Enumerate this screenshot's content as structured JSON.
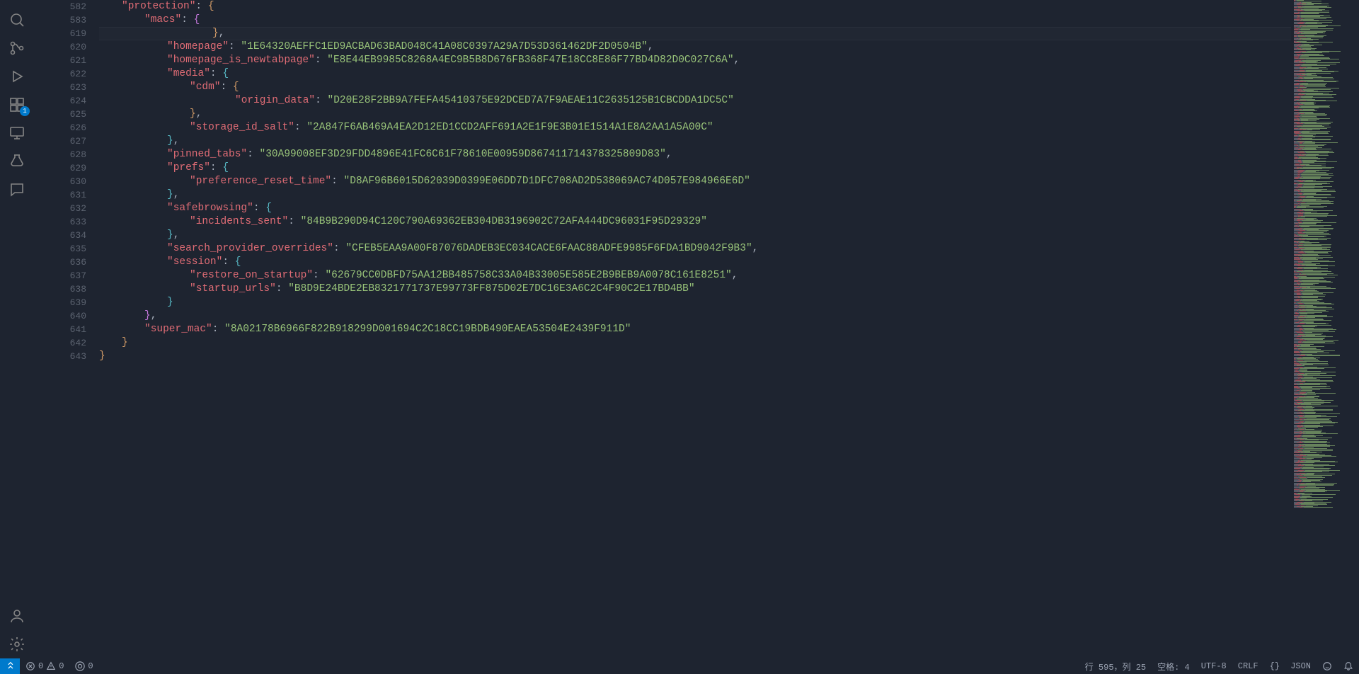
{
  "activity_bar": {
    "items": [
      {
        "name": "search-icon"
      },
      {
        "name": "source-control-icon"
      },
      {
        "name": "run-debug-icon"
      },
      {
        "name": "extensions-icon",
        "badge": "1"
      },
      {
        "name": "remote-explorer-icon"
      },
      {
        "name": "testing-icon"
      },
      {
        "name": "comments-icon"
      }
    ],
    "bottom": [
      {
        "name": "accounts-icon"
      },
      {
        "name": "settings-gear-icon"
      }
    ]
  },
  "editor": {
    "highlighted_line_index": 2,
    "lines": [
      {
        "num": 582,
        "indent": "ind1",
        "tokens": [
          {
            "t": "key",
            "v": "\"protection\""
          },
          {
            "t": "pun",
            "v": ": "
          },
          {
            "t": "brc",
            "v": "{"
          }
        ],
        "fold": true
      },
      {
        "num": 583,
        "indent": "ind2",
        "tokens": [
          {
            "t": "key",
            "v": "\"macs\""
          },
          {
            "t": "pun",
            "v": ": "
          },
          {
            "t": "brc2",
            "v": "{"
          }
        ],
        "fold": true
      },
      {
        "num": 619,
        "indent": "ind3",
        "tokens": [
          {
            "t": "brc",
            "v": "}"
          },
          {
            "t": "pun",
            "v": ","
          }
        ]
      },
      {
        "num": 620,
        "indent": "ind4",
        "tokens": [
          {
            "t": "key",
            "v": "\"homepage\""
          },
          {
            "t": "pun",
            "v": ": "
          },
          {
            "t": "str",
            "v": "\"1E64320AEFFC1ED9ACBAD63BAD048C41A08C0397A29A7D53D361462DF2D0504B\""
          },
          {
            "t": "pun",
            "v": ","
          }
        ]
      },
      {
        "num": 621,
        "indent": "ind4",
        "tokens": [
          {
            "t": "key",
            "v": "\"homepage_is_newtabpage\""
          },
          {
            "t": "pun",
            "v": ": "
          },
          {
            "t": "str",
            "v": "\"E8E44EB9985C8268A4EC9B5B8D676FB368F47E18CC8E86F77BD4D82D0C027C6A\""
          },
          {
            "t": "pun",
            "v": ","
          }
        ]
      },
      {
        "num": 622,
        "indent": "ind4",
        "tokens": [
          {
            "t": "key",
            "v": "\"media\""
          },
          {
            "t": "pun",
            "v": ": "
          },
          {
            "t": "brc3",
            "v": "{"
          }
        ]
      },
      {
        "num": 623,
        "indent": "ind5",
        "tokens": [
          {
            "t": "key",
            "v": "\"cdm\""
          },
          {
            "t": "pun",
            "v": ": "
          },
          {
            "t": "brc",
            "v": "{"
          }
        ]
      },
      {
        "num": 624,
        "indent": "ind6",
        "tokens": [
          {
            "t": "key",
            "v": "\"origin_data\""
          },
          {
            "t": "pun",
            "v": ": "
          },
          {
            "t": "str",
            "v": "\"D20E28F2BB9A7FEFA45410375E92DCED7A7F9AEAE11C2635125B1CBCDDA1DC5C\""
          }
        ]
      },
      {
        "num": 625,
        "indent": "ind5",
        "tokens": [
          {
            "t": "brc",
            "v": "}"
          },
          {
            "t": "pun",
            "v": ","
          }
        ]
      },
      {
        "num": 626,
        "indent": "ind5",
        "tokens": [
          {
            "t": "key",
            "v": "\"storage_id_salt\""
          },
          {
            "t": "pun",
            "v": ": "
          },
          {
            "t": "str",
            "v": "\"2A847F6AB469A4EA2D12ED1CCD2AFF691A2E1F9E3B01E1514A1E8A2AA1A5A00C\""
          }
        ]
      },
      {
        "num": 627,
        "indent": "ind4",
        "tokens": [
          {
            "t": "brc3",
            "v": "}"
          },
          {
            "t": "pun",
            "v": ","
          }
        ]
      },
      {
        "num": 628,
        "indent": "ind4",
        "tokens": [
          {
            "t": "key",
            "v": "\"pinned_tabs\""
          },
          {
            "t": "pun",
            "v": ": "
          },
          {
            "t": "str",
            "v": "\"30A99008EF3D29FDD4896E41FC6C61F78610E00959D867411714378325809D83\""
          },
          {
            "t": "pun",
            "v": ","
          }
        ]
      },
      {
        "num": 629,
        "indent": "ind4",
        "tokens": [
          {
            "t": "key",
            "v": "\"prefs\""
          },
          {
            "t": "pun",
            "v": ": "
          },
          {
            "t": "brc3",
            "v": "{"
          }
        ]
      },
      {
        "num": 630,
        "indent": "ind5",
        "tokens": [
          {
            "t": "key",
            "v": "\"preference_reset_time\""
          },
          {
            "t": "pun",
            "v": ": "
          },
          {
            "t": "str",
            "v": "\"D8AF96B6015D62039D0399E06DD7D1DFC708AD2D538069AC74D057E984966E6D\""
          }
        ]
      },
      {
        "num": 631,
        "indent": "ind4",
        "tokens": [
          {
            "t": "brc3",
            "v": "}"
          },
          {
            "t": "pun",
            "v": ","
          }
        ]
      },
      {
        "num": 632,
        "indent": "ind4",
        "tokens": [
          {
            "t": "key",
            "v": "\"safebrowsing\""
          },
          {
            "t": "pun",
            "v": ": "
          },
          {
            "t": "brc3",
            "v": "{"
          }
        ]
      },
      {
        "num": 633,
        "indent": "ind5",
        "tokens": [
          {
            "t": "key",
            "v": "\"incidents_sent\""
          },
          {
            "t": "pun",
            "v": ": "
          },
          {
            "t": "str",
            "v": "\"84B9B290D94C120C790A69362EB304DB3196902C72AFA444DC96031F95D29329\""
          }
        ]
      },
      {
        "num": 634,
        "indent": "ind4",
        "tokens": [
          {
            "t": "brc3",
            "v": "}"
          },
          {
            "t": "pun",
            "v": ","
          }
        ]
      },
      {
        "num": 635,
        "indent": "ind4",
        "tokens": [
          {
            "t": "key",
            "v": "\"search_provider_overrides\""
          },
          {
            "t": "pun",
            "v": ": "
          },
          {
            "t": "str",
            "v": "\"CFEB5EAA9A00F87076DADEB3EC034CACE6FAAC88ADFE9985F6FDA1BD9042F9B3\""
          },
          {
            "t": "pun",
            "v": ","
          }
        ]
      },
      {
        "num": 636,
        "indent": "ind4",
        "tokens": [
          {
            "t": "key",
            "v": "\"session\""
          },
          {
            "t": "pun",
            "v": ": "
          },
          {
            "t": "brc3",
            "v": "{"
          }
        ]
      },
      {
        "num": 637,
        "indent": "ind5",
        "tokens": [
          {
            "t": "key",
            "v": "\"restore_on_startup\""
          },
          {
            "t": "pun",
            "v": ": "
          },
          {
            "t": "str",
            "v": "\"62679CC0DBFD75AA12BB485758C33A04B33005E585E2B9BEB9A0078C161E8251\""
          },
          {
            "t": "pun",
            "v": ","
          }
        ]
      },
      {
        "num": 638,
        "indent": "ind5",
        "tokens": [
          {
            "t": "key",
            "v": "\"startup_urls\""
          },
          {
            "t": "pun",
            "v": ": "
          },
          {
            "t": "str",
            "v": "\"B8D9E24BDE2EB8321771737E99773FF875D02E7DC16E3A6C2C4F90C2E17BD4BB\""
          }
        ]
      },
      {
        "num": 639,
        "indent": "ind4",
        "tokens": [
          {
            "t": "brc3",
            "v": "}"
          }
        ]
      },
      {
        "num": 640,
        "indent": "ind2",
        "tokens": [
          {
            "t": "brc2",
            "v": "}"
          },
          {
            "t": "pun",
            "v": ","
          }
        ],
        "indent_override": "padding-left:64px;"
      },
      {
        "num": 641,
        "indent": "ind2",
        "tokens": [
          {
            "t": "key",
            "v": "\"super_mac\""
          },
          {
            "t": "pun",
            "v": ": "
          },
          {
            "t": "str",
            "v": "\"8A02178B6966F822B918299D001694C2C18CC19BDB490EAEA53504E2439F911D\""
          }
        ]
      },
      {
        "num": 642,
        "indent": "ind1",
        "tokens": [
          {
            "t": "brc",
            "v": "}"
          }
        ]
      },
      {
        "num": 643,
        "indent": "ind0",
        "tokens": [
          {
            "t": "brc",
            "v": "}"
          }
        ]
      }
    ]
  },
  "status_bar": {
    "errors": "0",
    "warnings": "0",
    "ports": "0",
    "cursor": "行 595，列 25",
    "spaces": "空格: 4",
    "encoding": "UTF-8",
    "eol": "CRLF",
    "language_prefix": "{}",
    "language": "JSON"
  }
}
